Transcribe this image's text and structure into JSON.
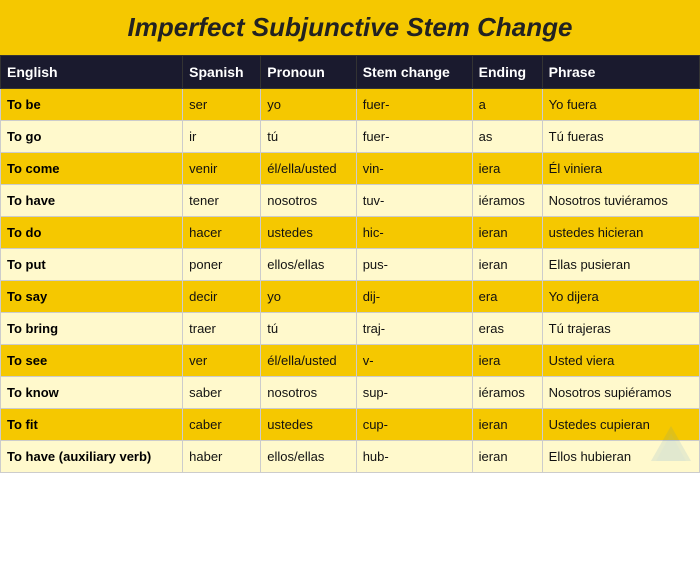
{
  "title": "Imperfect Subjunctive Stem Change",
  "headers": [
    "English",
    "Spanish",
    "Pronoun",
    "Stem change",
    "Ending",
    "Phrase"
  ],
  "rows": [
    {
      "english": "To be",
      "spanish": "ser",
      "pronoun": "yo",
      "stem": "fuer-",
      "ending": "a",
      "phrase": "Yo fuera"
    },
    {
      "english": "To go",
      "spanish": "ir",
      "pronoun": "tú",
      "stem": "fuer-",
      "ending": "as",
      "phrase": "Tú fueras"
    },
    {
      "english": "To come",
      "spanish": "venir",
      "pronoun": "él/ella/usted",
      "stem": "vin-",
      "ending": "iera",
      "phrase": "Él viniera"
    },
    {
      "english": "To have",
      "spanish": "tener",
      "pronoun": "nosotros",
      "stem": "tuv-",
      "ending": "iéramos",
      "phrase": "Nosotros tuviéramos"
    },
    {
      "english": "To do",
      "spanish": "hacer",
      "pronoun": "ustedes",
      "stem": "hic-",
      "ending": "ieran",
      "phrase": "ustedes hicieran"
    },
    {
      "english": "To put",
      "spanish": "poner",
      "pronoun": "ellos/ellas",
      "stem": "pus-",
      "ending": "ieran",
      "phrase": "Ellas pusieran"
    },
    {
      "english": "To say",
      "spanish": "decir",
      "pronoun": "yo",
      "stem": "dij-",
      "ending": "era",
      "phrase": "Yo dijera"
    },
    {
      "english": "To bring",
      "spanish": "traer",
      "pronoun": "tú",
      "stem": "traj-",
      "ending": "eras",
      "phrase": "Tú trajeras"
    },
    {
      "english": "To see",
      "spanish": "ver",
      "pronoun": "él/ella/usted",
      "stem": "v-",
      "ending": "iera",
      "phrase": "Usted viera"
    },
    {
      "english": "To know",
      "spanish": "saber",
      "pronoun": "nosotros",
      "stem": "sup-",
      "ending": "iéramos",
      "phrase": "Nosotros supiéramos"
    },
    {
      "english": "To fit",
      "spanish": "caber",
      "pronoun": "ustedes",
      "stem": "cup-",
      "ending": "ieran",
      "phrase": "Ustedes cupieran"
    },
    {
      "english": "To have (auxiliary verb)",
      "spanish": "haber",
      "pronoun": "ellos/ellas",
      "stem": "hub-",
      "ending": "ieran",
      "phrase": "Ellos hubieran"
    }
  ]
}
